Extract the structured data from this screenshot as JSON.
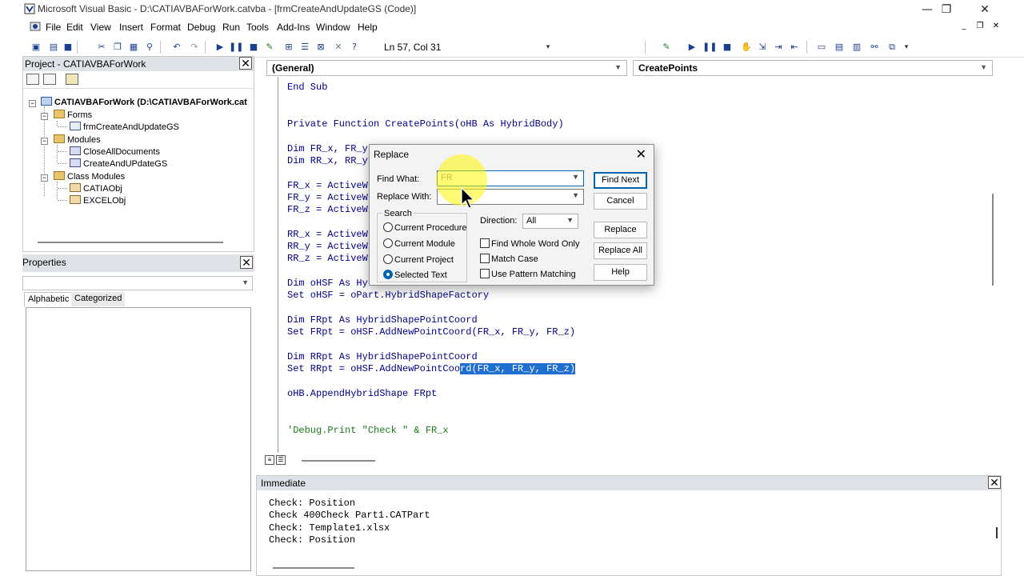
{
  "window": {
    "title": "Microsoft Visual Basic - D:\\CATIAVBAForWork.catvba - [frmCreateAndUpdateGS (Code)]",
    "minimize_glyph": "—",
    "restore_glyph": "❐",
    "close_glyph": "✕"
  },
  "menubar": {
    "items": [
      "File",
      "Edit",
      "View",
      "Insert",
      "Format",
      "Debug",
      "Run",
      "Tools",
      "Add-Ins",
      "Window",
      "Help"
    ],
    "mdi_min": "_",
    "mdi_restore": "❐",
    "mdi_close": "✕"
  },
  "toolbar": {
    "cursor_position": "Ln 57, Col 31"
  },
  "project_explorer": {
    "title": "Project - CATIAVBAForWork",
    "close_glyph": "✕",
    "tree": {
      "root": "CATIAVBAForWork (D:\\CATIAVBAForWork.cat",
      "forms_folder": "Forms",
      "form1": "frmCreateAndUpdateGS",
      "modules_folder": "Modules",
      "module1": "CloseAllDocuments",
      "module2": "CreateAndUPdateGS",
      "class_folder": "Class Modules",
      "class1": "CATIAObj",
      "class2": "EXCELObj"
    }
  },
  "properties": {
    "title": "Properties",
    "close_glyph": "✕",
    "tab_alphabetic": "Alphabetic",
    "tab_categorized": "Categorized"
  },
  "code": {
    "object_combo": "(General)",
    "procedure_combo": "CreatePoints",
    "lines": {
      "l1": "End Sub",
      "l2": "Private Function CreatePoints(oHB As HybridBody)",
      "l3": "Dim FR_x, FR_y",
      "l4": "Dim RR_x, RR_y",
      "l5": "FR_x = ActiveW",
      "l6": "FR_y = ActiveW",
      "l7": "FR_z = ActiveW",
      "l8": "RR_x = ActiveW",
      "l9": "RR_y = ActiveW",
      "l10": "RR_z = ActiveW",
      "l11": "Dim oHSF As Hy",
      "l12": "Set oHSF = oPart.HybridShapeFactory",
      "l13": "Dim FRpt As HybridShapePointCoord",
      "l14": "Set FRpt = oHSF.AddNewPointCoord(FR_x, FR_y, FR_z)",
      "l15": "Dim RRpt As HybridShapePointCoord",
      "l16a": "Set RRpt = oHSF.AddNewPointCoo",
      "l16b": "rd(FR_x, FR_y, FR_z)",
      "l17": "oHB.AppendHybridShape FRpt",
      "l18": "'Debug.Print \"Check \" & FR_x"
    }
  },
  "immediate": {
    "title": "Immediate",
    "close_glyph": "✕",
    "lines": [
      "Check: Position",
      "Check 400Check Part1.CATPart",
      "Check: Template1.xlsx",
      "Check: Position"
    ]
  },
  "replace_dialog": {
    "title": "Replace",
    "close_glyph": "✕",
    "find_label": "Find What:",
    "find_value": "FR",
    "replace_label": "Replace With:",
    "replace_value": "",
    "search_label": "Search",
    "scope_options": [
      "Current Procedure",
      "Current Module",
      "Current Project",
      "Selected Text"
    ],
    "selected_scope": "Selected Text",
    "direction_label": "Direction:",
    "direction_value": "All",
    "find_whole_word": "Find Whole Word Only",
    "match_case": "Match Case",
    "use_pattern": "Use Pattern Matching",
    "buttons": {
      "find_next": "Find Next",
      "cancel": "Cancel",
      "replace": "Replace",
      "replace_all": "Replace All",
      "help": "Help"
    }
  },
  "colors": {
    "keyword": "#00008b",
    "comment": "#1a7a1a",
    "selection": "#1f6fd1",
    "accent": "#0063b1"
  }
}
